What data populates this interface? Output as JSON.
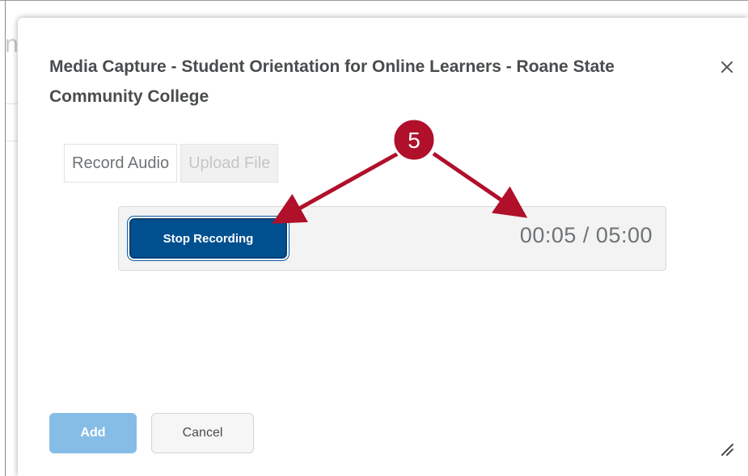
{
  "dialog": {
    "title": "Media Capture - Student Orientation for Online Learners - Roane State Community College",
    "close_symbol": "×"
  },
  "tabs": [
    {
      "label": "Record Audio",
      "state": "active"
    },
    {
      "label": "Upload File",
      "state": "disabled"
    }
  ],
  "recorder": {
    "stop_label": "Stop Recording",
    "timer": "00:05 / 05:00"
  },
  "footer": {
    "add_label": "Add",
    "cancel_label": "Cancel"
  },
  "annotation": {
    "step_number": "5",
    "marker_color": "#b0102a"
  },
  "colors": {
    "primary": "#005090",
    "primary_disabled": "#86bde6",
    "text": "#494c4e"
  }
}
